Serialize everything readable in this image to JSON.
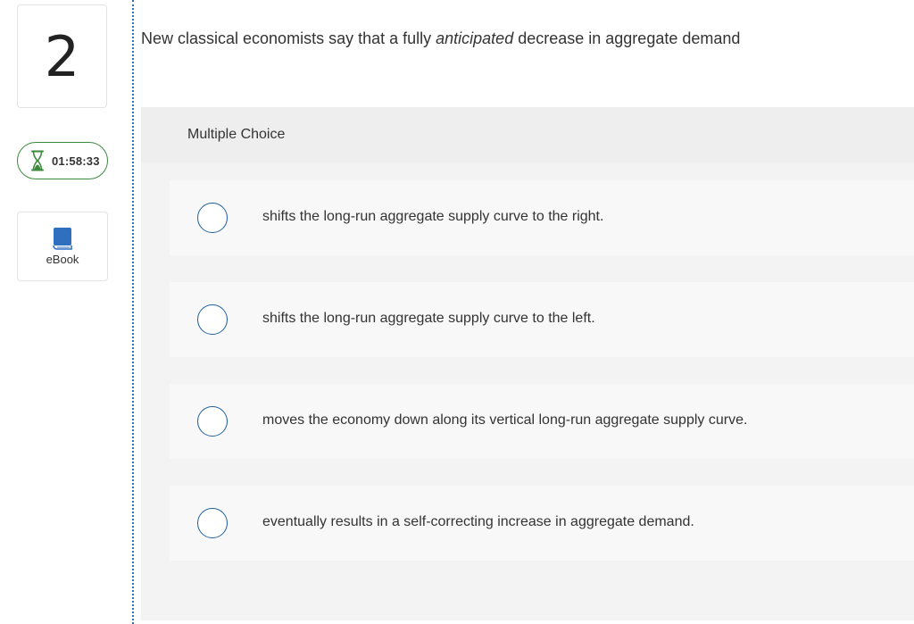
{
  "question_number": "2",
  "timer": {
    "icon": "hourglass-icon",
    "value": "01:58:33",
    "color": "#3d8a3d"
  },
  "ebook": {
    "icon": "book-icon",
    "label": "eBook",
    "color": "#2f6fc0"
  },
  "question": {
    "before": "New classical economists say that a fully ",
    "emphasis": "anticipated",
    "after": " decrease in aggregate demand"
  },
  "multiple_choice": {
    "title": "Multiple Choice",
    "options": [
      {
        "label": "shifts the long-run aggregate supply curve to the right.",
        "selected": false
      },
      {
        "label": "shifts the long-run aggregate supply curve to the left.",
        "selected": false
      },
      {
        "label": "moves the economy down along its vertical long-run aggregate supply curve.",
        "selected": false
      },
      {
        "label": "eventually results in a self-correcting increase in aggregate demand.",
        "selected": false
      }
    ]
  },
  "colors": {
    "accent_blue": "#1e5f9e",
    "divider": "#2f6fb0"
  }
}
